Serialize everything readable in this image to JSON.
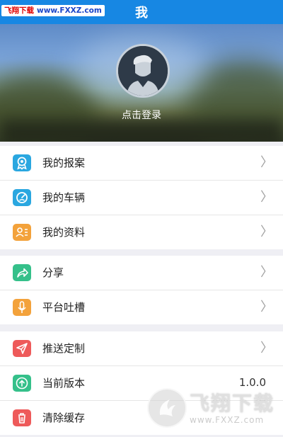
{
  "header": {
    "title": "我"
  },
  "watermark_top": {
    "site": "飞翔下载",
    "url": "www.FXXZ.com"
  },
  "profile": {
    "login_text": "点击登录"
  },
  "menu_groups": [
    [
      {
        "label": "我的报案",
        "icon": "badge-icon",
        "color": "#2aa7e0"
      },
      {
        "label": "我的车辆",
        "icon": "speedometer-icon",
        "color": "#2aa7e0"
      },
      {
        "label": "我的资料",
        "icon": "profile-card-icon",
        "color": "#f3a23b"
      }
    ],
    [
      {
        "label": "分享",
        "icon": "share-icon",
        "color": "#35c08a"
      },
      {
        "label": "平台吐槽",
        "icon": "microphone-icon",
        "color": "#f3a23b"
      }
    ],
    [
      {
        "label": "推送定制",
        "icon": "paper-plane-icon",
        "color": "#ee5a5a"
      },
      {
        "label": "当前版本",
        "icon": "cloud-upload-icon",
        "color": "#35c08a",
        "value": "1.0.0"
      },
      {
        "label": "清除缓存",
        "icon": "trash-icon",
        "color": "#ee5a5a"
      }
    ]
  ],
  "watermark_bottom": {
    "brand": "飞翔下载",
    "url": "www.FXXZ.com"
  }
}
